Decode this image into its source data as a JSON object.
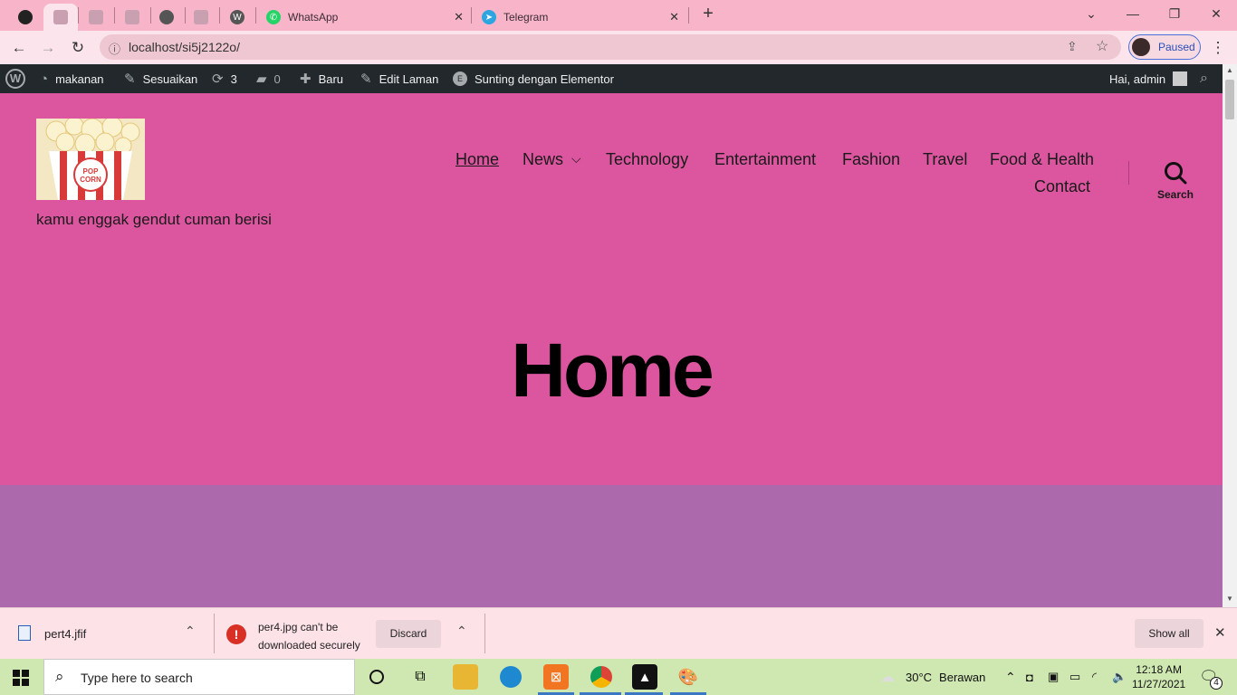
{
  "browser": {
    "tabs": [
      {
        "title": "",
        "active": false
      },
      {
        "title": "",
        "active": true
      },
      {
        "title": "",
        "active": false
      },
      {
        "title": "",
        "active": false
      },
      {
        "title": "",
        "active": false
      },
      {
        "title": "",
        "active": false
      },
      {
        "title": "",
        "active": false
      },
      {
        "title": "WhatsApp",
        "active": false
      },
      {
        "title": "Telegram",
        "active": false
      }
    ],
    "new_tab": "+",
    "url": "localhost/si5j2122o/",
    "profile_status": "Paused"
  },
  "admin_bar": {
    "site_name": "makanan",
    "customize": "Sesuaikan",
    "updates_count": "3",
    "comments_count": "0",
    "new": "Baru",
    "edit_page": "Edit Laman",
    "elementor": "Sunting dengan Elementor",
    "greeting": "Hai, admin"
  },
  "site": {
    "tagline": "kamu enggak gendut cuman berisi",
    "logo_text": "POP CORN",
    "menu": [
      "Home",
      "News",
      "Technology",
      "Entertainment",
      "Fashion",
      "Travel",
      "Food & Health",
      "Contact"
    ],
    "search_label": "Search",
    "hero_title": "Home",
    "colors": {
      "header_bg": "#dc559f",
      "content_bg": "#ac6aad"
    }
  },
  "downloads": {
    "item1": "pert4.jfif",
    "item2_line1": "per4.jpg can't be",
    "item2_line2": "downloaded securely",
    "discard": "Discard",
    "show_all": "Show all"
  },
  "taskbar": {
    "search_placeholder": "Type here to search",
    "weather_temp": "30°C",
    "weather_text": "Berawan",
    "time": "12:18 AM",
    "date": "11/27/2021",
    "notifications": "4"
  }
}
